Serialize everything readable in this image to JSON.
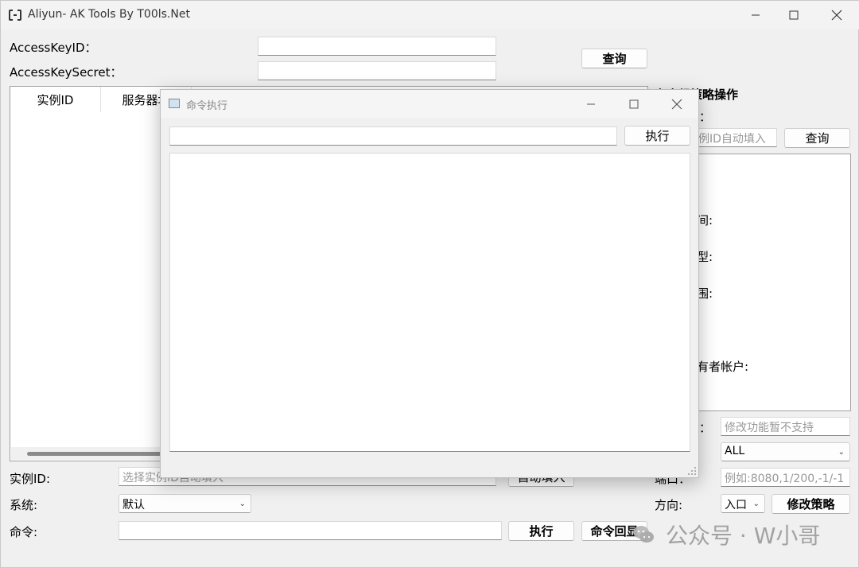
{
  "window": {
    "title": "Aliyun- AK Tools By T00ls.Net"
  },
  "credentials": {
    "access_key_id_label": "AccessKeyID：",
    "access_key_secret_label": "AccessKeySecret：",
    "query_label": "查询"
  },
  "table": {
    "columns": [
      "实例ID",
      "服务器地"
    ]
  },
  "security_group": {
    "title_partial": "安全组策略操作",
    "label1_partial": "：",
    "instance_placeholder_partial": "例ID自动填入",
    "query_label": "查询",
    "info_labels": [
      "间:",
      "型:",
      "围:",
      "有者帐户:"
    ],
    "rule_label_partial": "：",
    "rule_placeholder": "修改功能暂不支持",
    "protocol_value": "ALL",
    "port_label_partial": "端口：",
    "port_placeholder": "例如:8080,1/200,-1/-1",
    "direction_label": "方向:",
    "direction_value": "入口",
    "modify_label": "修改策略"
  },
  "bottom": {
    "instance_label": "实例ID:",
    "instance_placeholder": "选择实例ID自动填入",
    "autofill_label": "自动填入",
    "system_label": "系统:",
    "system_value": "默认",
    "command_label": "命令:",
    "exec_label": "执行",
    "echo_label": "命令回显"
  },
  "dialog": {
    "title": "命令执行",
    "exec_label": "执行"
  },
  "watermark": {
    "text": "公众号 · W小哥"
  }
}
